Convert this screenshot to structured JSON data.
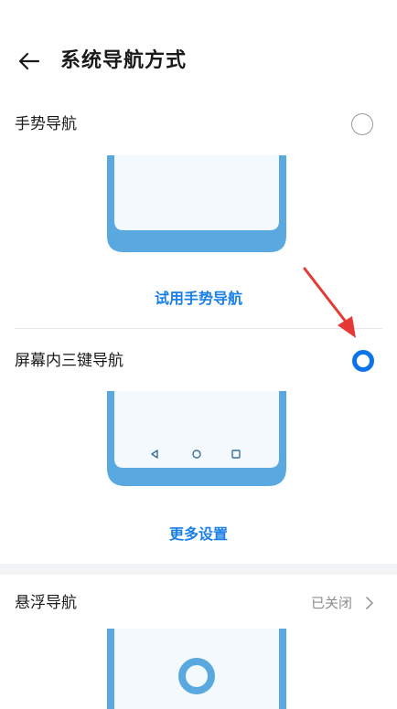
{
  "header": {
    "title": "系统导航方式",
    "back_icon": "arrow-left-icon"
  },
  "options": {
    "gesture": {
      "label": "手势导航",
      "selected": false,
      "try_label": "试用手势导航"
    },
    "three_key": {
      "label": "屏幕内三键导航",
      "selected": true,
      "more_label": "更多设置"
    },
    "floating": {
      "label": "悬浮导航",
      "status": "已关闭",
      "chevron_icon": "chevron-right-icon"
    }
  },
  "colors": {
    "accent": "#0a74e8",
    "link": "#1a7fe6",
    "phone_frame": "#5aa8e0",
    "phone_screen": "#f3f9fd",
    "annotation_arrow": "#e53935"
  }
}
